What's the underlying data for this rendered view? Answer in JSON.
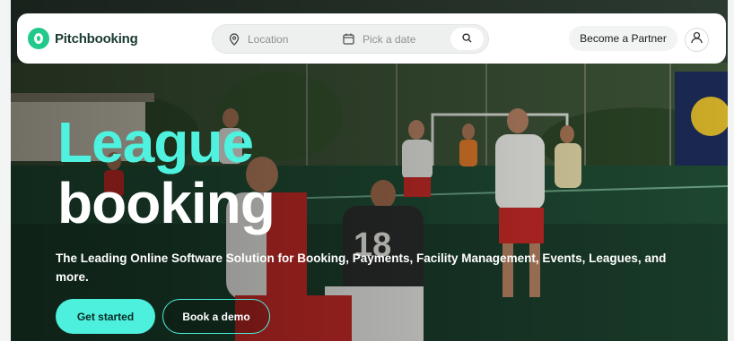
{
  "brand": {
    "name": "Pitchbooking",
    "accent": "#22c98b"
  },
  "search": {
    "location_placeholder": "Location",
    "date_placeholder": "Pick a date"
  },
  "nav": {
    "partner_label": "Become a Partner"
  },
  "hero": {
    "headline_1": "League",
    "headline_2": "booking",
    "subtitle": "The Leading Online Software Solution for Booking, Payments, Facility Management, Events, Leagues, and more.",
    "cta_primary": "Get started",
    "cta_secondary": "Book a demo",
    "highlight_color": "#4ef2de"
  },
  "jersey_number": "18",
  "icons": [
    "logo-icon",
    "location-pin-icon",
    "calendar-icon",
    "search-icon",
    "user-icon"
  ]
}
